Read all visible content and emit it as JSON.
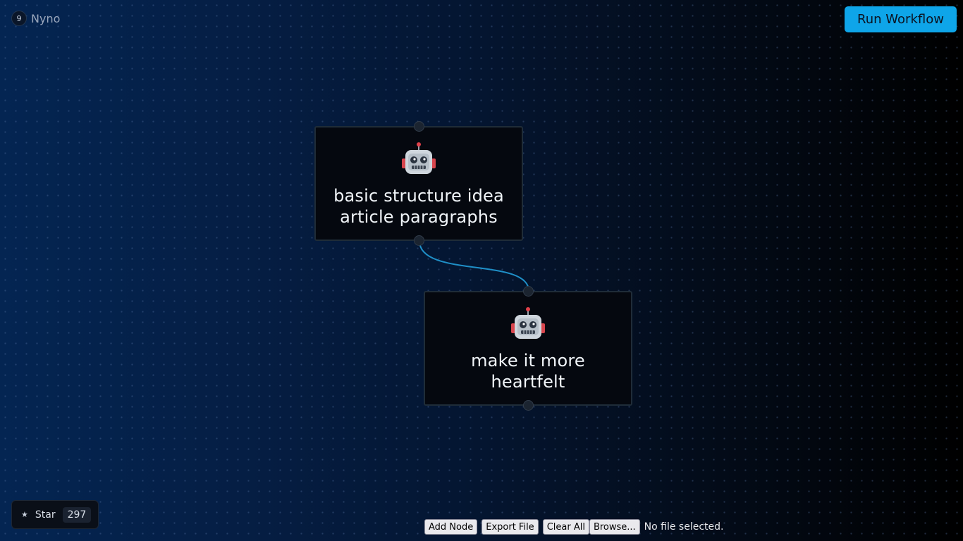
{
  "app": {
    "name": "Nyno",
    "logo_text": "9"
  },
  "header": {
    "run_label": "Run Workflow"
  },
  "nodes": [
    {
      "icon": "robot-icon",
      "label": "basic structure idea article paragraphs"
    },
    {
      "icon": "robot-icon",
      "label": "make it more heartfelt"
    }
  ],
  "edge": {
    "from": 0,
    "to": 1,
    "color": "#1f8fc7"
  },
  "github": {
    "star_label": "Star",
    "star_count": "297"
  },
  "toolbar": {
    "add_node_label": "Add Node",
    "export_label": "Export File",
    "clear_label": "Clear All",
    "browse_label": "Browse...",
    "file_status": "No file selected."
  },
  "colors": {
    "accent": "#0ea5e9",
    "node_bg": "#05080f",
    "node_border": "#1f2c38"
  }
}
